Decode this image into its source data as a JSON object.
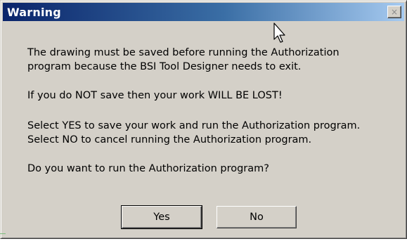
{
  "dialog": {
    "title": "Warning",
    "close_glyph": "×",
    "close_icon": "close-icon",
    "cursor_icon": "arrow-cursor-icon",
    "message_lines": [
      "The drawing must be saved before running the Authorization",
      "program because the BSI Tool Designer needs to exit.",
      "If you do NOT save then your work WILL BE LOST!",
      "Select YES to save your work and run the Authorization program.",
      "Select NO to cancel running the Authorization program.",
      "Do you want to run the Authorization program?"
    ],
    "buttons": {
      "yes_label": "Yes",
      "no_label": "No"
    }
  },
  "colors": {
    "titlebar_start": "#0a246a",
    "titlebar_end": "#a6caf0",
    "face": "#d4d0c8",
    "title_text": "#ffffff"
  }
}
